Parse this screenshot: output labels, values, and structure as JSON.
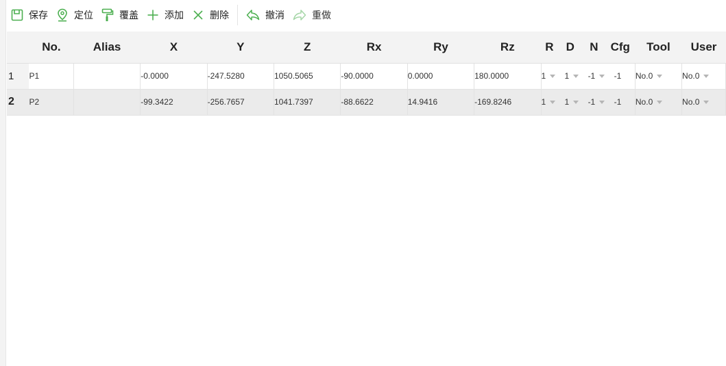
{
  "toolbar": {
    "save": "保存",
    "locate": "定位",
    "overwrite": "覆盖",
    "add": "添加",
    "delete": "删除",
    "undo": "撤消",
    "redo": "重做"
  },
  "colors": {
    "accent": "#4caf50",
    "disabled": "#a5d6a7"
  },
  "columns": [
    "No.",
    "Alias",
    "X",
    "Y",
    "Z",
    "Rx",
    "Ry",
    "Rz",
    "R",
    "D",
    "N",
    "Cfg",
    "Tool",
    "User"
  ],
  "rows": [
    {
      "index": "1",
      "no": "P1",
      "alias": "",
      "x": "-0.0000",
      "y": "-247.5280",
      "z": "1050.5065",
      "rx": "-90.0000",
      "ry": "0.0000",
      "rz": "180.0000",
      "r": "1",
      "d": "1",
      "n": "-1",
      "cfg": "-1",
      "tool": "No.0",
      "user": "No.0"
    },
    {
      "index": "2",
      "no": "P2",
      "alias": "",
      "x": "-99.3422",
      "y": "-256.7657",
      "z": "1041.7397",
      "rx": "-88.6622",
      "ry": "14.9416",
      "rz": "-169.8246",
      "r": "1",
      "d": "1",
      "n": "-1",
      "cfg": "-1",
      "tool": "No.0",
      "user": "No.0"
    }
  ]
}
